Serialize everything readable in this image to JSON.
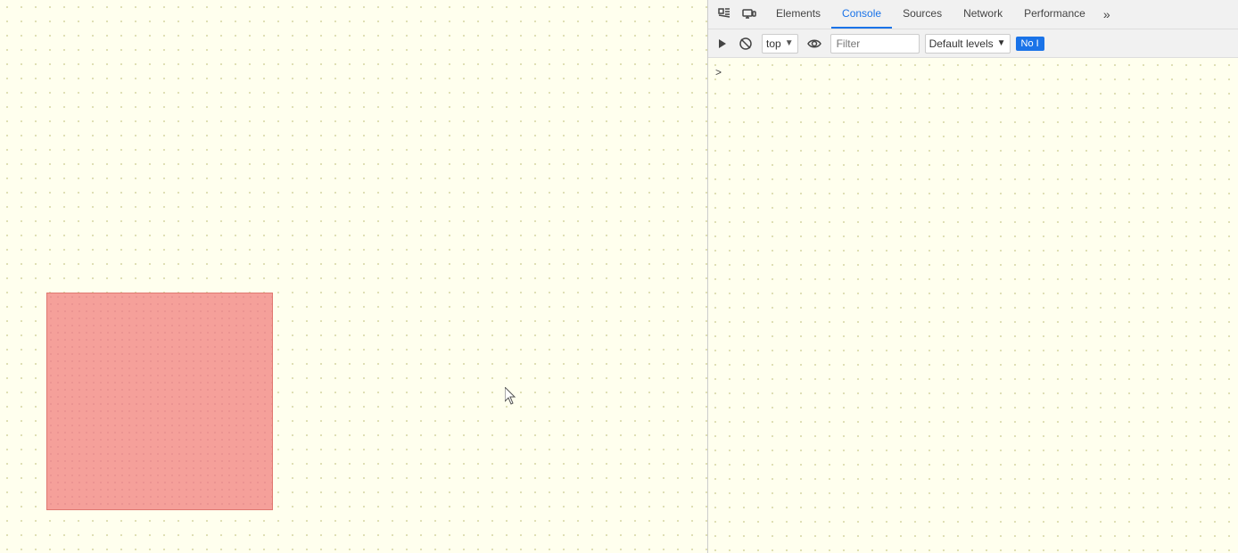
{
  "page": {
    "background_color": "#ffffee",
    "pink_box": {
      "color": "#f5a09a",
      "border_color": "#e07870"
    }
  },
  "devtools": {
    "tabs": [
      {
        "id": "elements",
        "label": "Elements",
        "active": false
      },
      {
        "id": "console",
        "label": "Console",
        "active": true
      },
      {
        "id": "sources",
        "label": "Sources",
        "active": false
      },
      {
        "id": "network",
        "label": "Network",
        "active": false
      },
      {
        "id": "performance",
        "label": "Performance",
        "active": false
      }
    ],
    "more_tabs_icon": "⋮",
    "toolbar_left_icon1": "inspect",
    "toolbar_left_icon2": "device",
    "console_toolbar": {
      "clear_label": "🚫",
      "context_value": "top",
      "eye_label": "👁",
      "filter_placeholder": "Filter",
      "log_level_label": "Default levels",
      "no_issues_label": "No I"
    },
    "console_prompt_arrow": ">"
  }
}
